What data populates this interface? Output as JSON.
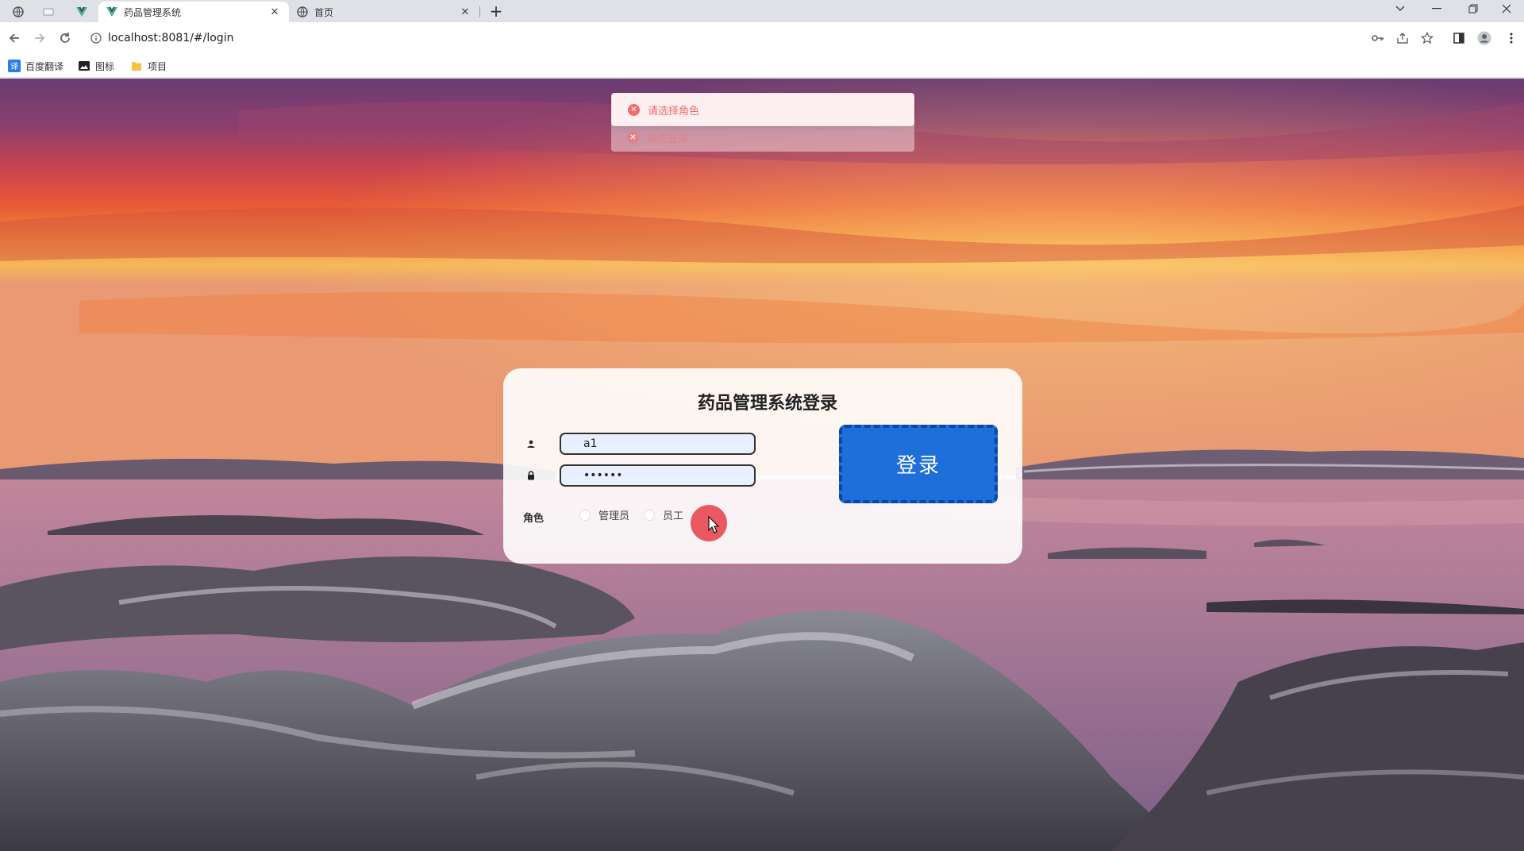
{
  "browser": {
    "tabs": [
      {
        "label": "药品管理系统",
        "active": true
      },
      {
        "label": "首页",
        "active": false
      }
    ],
    "url": "localhost:8081/#/login",
    "bookmarks": [
      {
        "label": "百度翻译",
        "icon": "translate-icon"
      },
      {
        "label": "图标",
        "icon": "image-icon"
      },
      {
        "label": "项目",
        "icon": "folder-icon"
      }
    ]
  },
  "messages": [
    {
      "text": "请选择角色",
      "type": "error"
    },
    {
      "text": "请先登录",
      "type": "error"
    }
  ],
  "login": {
    "title": "药品管理系统登录",
    "username_value": "a1",
    "password_value": "••••••",
    "role_label": "角色",
    "roles": [
      "管理员",
      "员工"
    ],
    "submit_label": "登录"
  },
  "colors": {
    "accent": "#1e6fd9",
    "error": "#f56c6c",
    "click_indicator": "#e83c46"
  }
}
